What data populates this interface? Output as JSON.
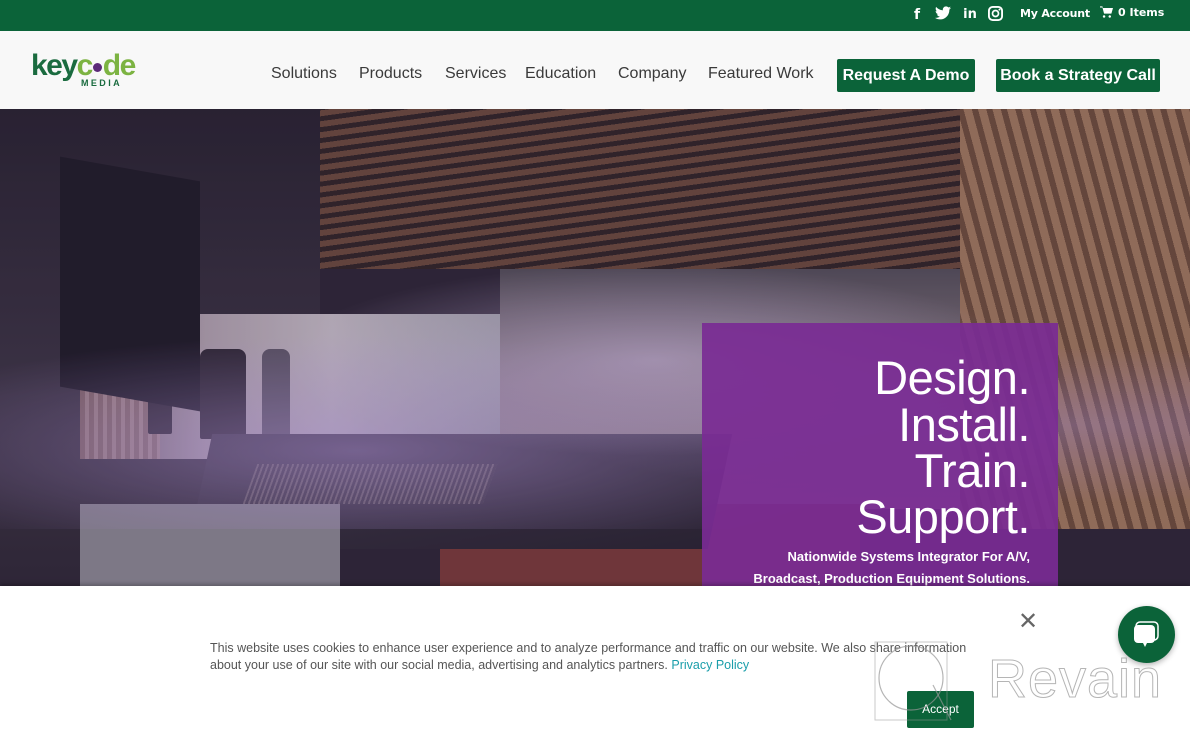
{
  "topbar": {
    "social": [
      {
        "name": "facebook",
        "glyph": "f"
      },
      {
        "name": "twitter",
        "glyph": "t"
      },
      {
        "name": "linkedin",
        "glyph": "in"
      },
      {
        "name": "instagram",
        "glyph": "◎"
      }
    ],
    "my_account": "My Account",
    "cart_label": "0 Items"
  },
  "header": {
    "logo": {
      "part1": "key",
      "part2": "c",
      "part3": "de",
      "sub": "MEDIA"
    },
    "nav": [
      "Solutions",
      "Products",
      "Services",
      "Education",
      "Company",
      "Featured Work"
    ],
    "cta_demo": "Request A Demo",
    "cta_strategy": "Book a Strategy Call"
  },
  "hero": {
    "headline": [
      "Design.",
      "Install.",
      "Train.",
      "Support."
    ],
    "subline": [
      "Nationwide Systems Integrator For A/V,",
      "Broadcast, Production Equipment Solutions."
    ]
  },
  "cookie": {
    "text": "This website uses cookies to enhance user experience and to analyze performance and traffic on our website. We also share information about your use of our site with our social media, advertising and analytics partners.",
    "privacy_link": "Privacy Policy",
    "close_glyph": "✕",
    "accept_label": "Accept"
  },
  "watermark": {
    "text": "Revain"
  },
  "colors": {
    "brand_green": "#0b6339",
    "purple": "#7a2b94",
    "link": "#1a9eaa"
  }
}
